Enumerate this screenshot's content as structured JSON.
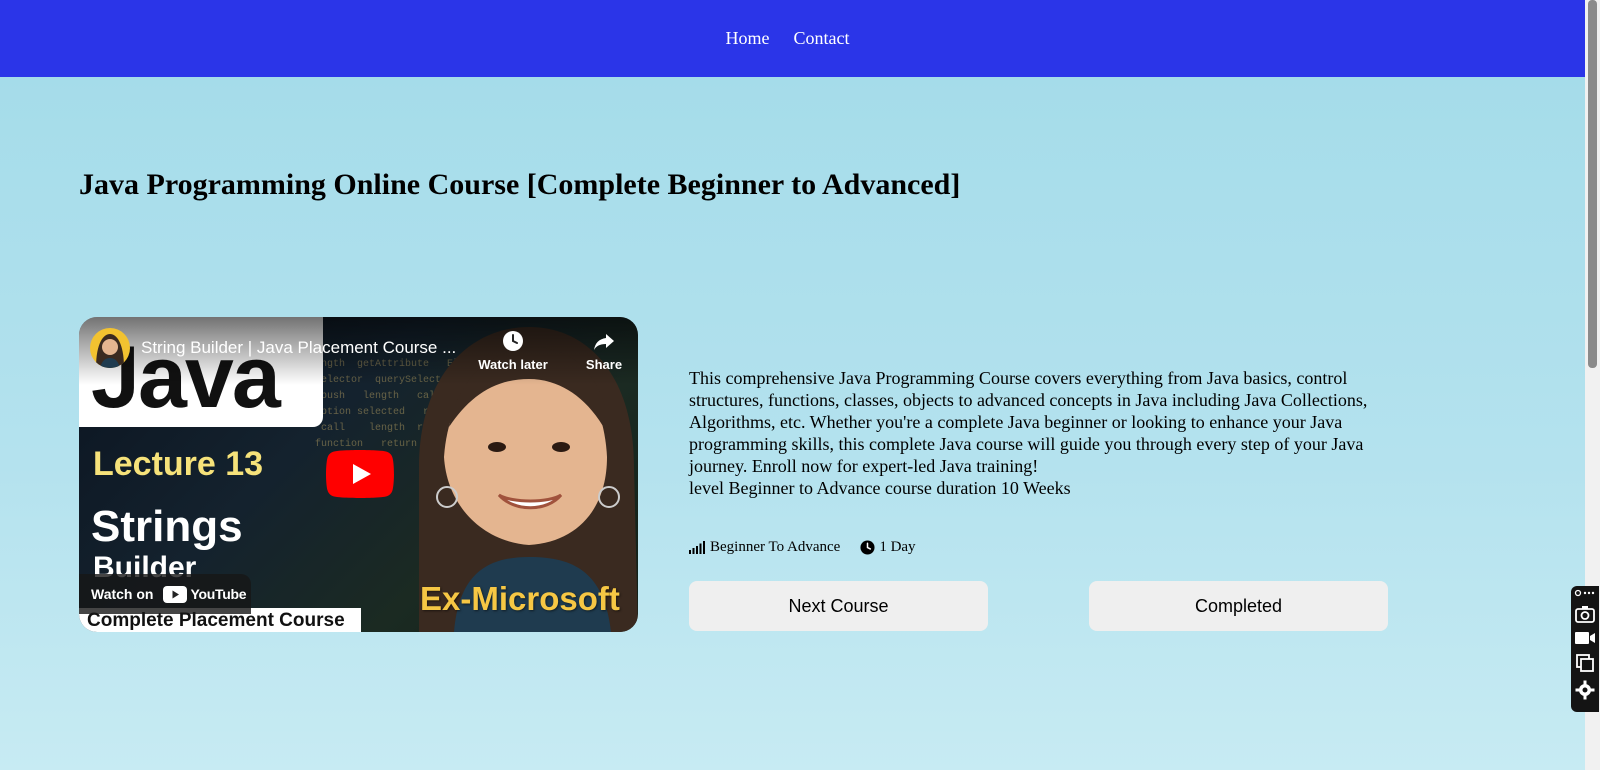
{
  "nav": {
    "links": [
      "Home",
      "Contact"
    ]
  },
  "page": {
    "title": "Java Programming Online Course [Complete Beginner to Advanced]"
  },
  "video": {
    "title": "String Builder | Java Placement Course ...",
    "watch_later": "Watch later",
    "share": "Share",
    "watch_on": "Watch on",
    "youtube": "YouTube",
    "thumbnail": {
      "java": "Java",
      "lecture": "Lecture 13",
      "strings": "Strings",
      "builder": "Builder",
      "strip": "Complete Placement Course",
      "ex_microsoft": "Ex-Microsoft"
    }
  },
  "course": {
    "description": "This comprehensive Java Programming Course covers everything from Java basics, control structures, functions, classes, objects to advanced concepts in Java including Java Collections, Algorithms, etc. Whether you're a complete Java beginner or looking to enhance your Java programming skills, this complete Java course will guide you through every step of your Java journey. Enroll now for expert-led Java training!",
    "level_line": "level Beginner to Advance course duration 10 Weeks",
    "level": "Beginner To Advance",
    "duration": "1 Day"
  },
  "buttons": {
    "next": "Next Course",
    "completed": "Completed"
  },
  "colors": {
    "navbar": "#2b35e8",
    "background": "#a2dbe9",
    "button": "#efefef"
  },
  "icons": [
    "signal-icon",
    "clock-icon",
    "play-icon",
    "share-icon",
    "camera-icon",
    "video-icon",
    "copy-icon",
    "gear-icon",
    "link-icon"
  ]
}
